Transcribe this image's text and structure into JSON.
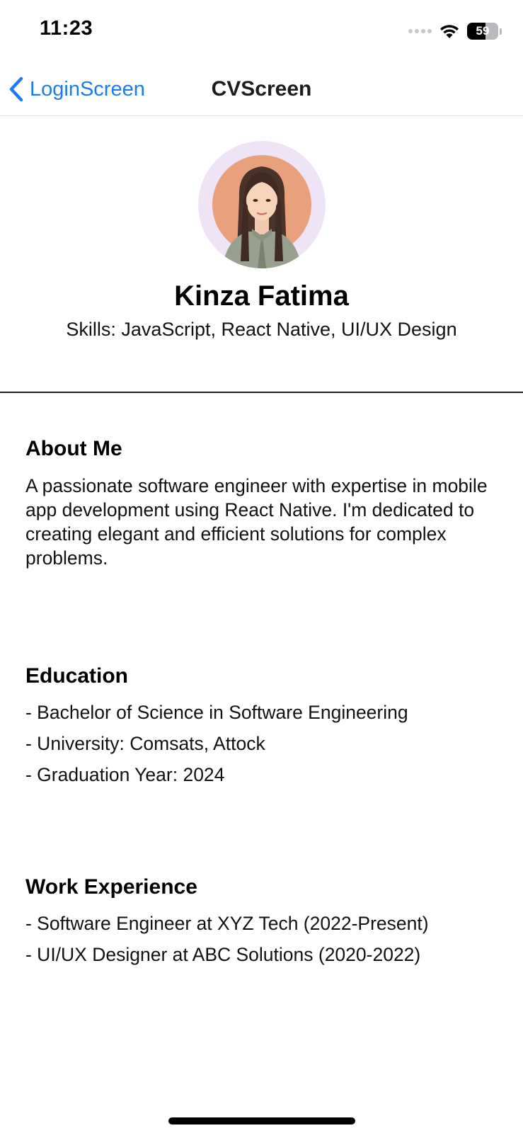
{
  "status_bar": {
    "time": "11:23",
    "battery_level": "59",
    "battery_fraction": 0.59
  },
  "nav": {
    "back_label": "LoginScreen",
    "title": "CVScreen"
  },
  "profile": {
    "name": "Kinza Fatima",
    "skills": "Skills: JavaScript, React Native, UI/UX Design"
  },
  "about": {
    "title": "About Me",
    "text": "A passionate software engineer with expertise in mobile app development using React Native. I'm dedicated to creating elegant and efficient solutions for complex problems."
  },
  "education": {
    "title": "Education",
    "items": [
      "- Bachelor of Science in Software Engineering",
      "- University: Comsats, Attock",
      "- Graduation Year: 2024"
    ]
  },
  "work": {
    "title": "Work Experience",
    "items": [
      "- Software Engineer at XYZ Tech (2022-Present)",
      "- UI/UX Designer at ABC Solutions (2020-2022)"
    ]
  },
  "colors": {
    "accent": "#1a7cf0",
    "avatar_background": "#e9a07c",
    "avatar_ring": "#efe3f6"
  }
}
